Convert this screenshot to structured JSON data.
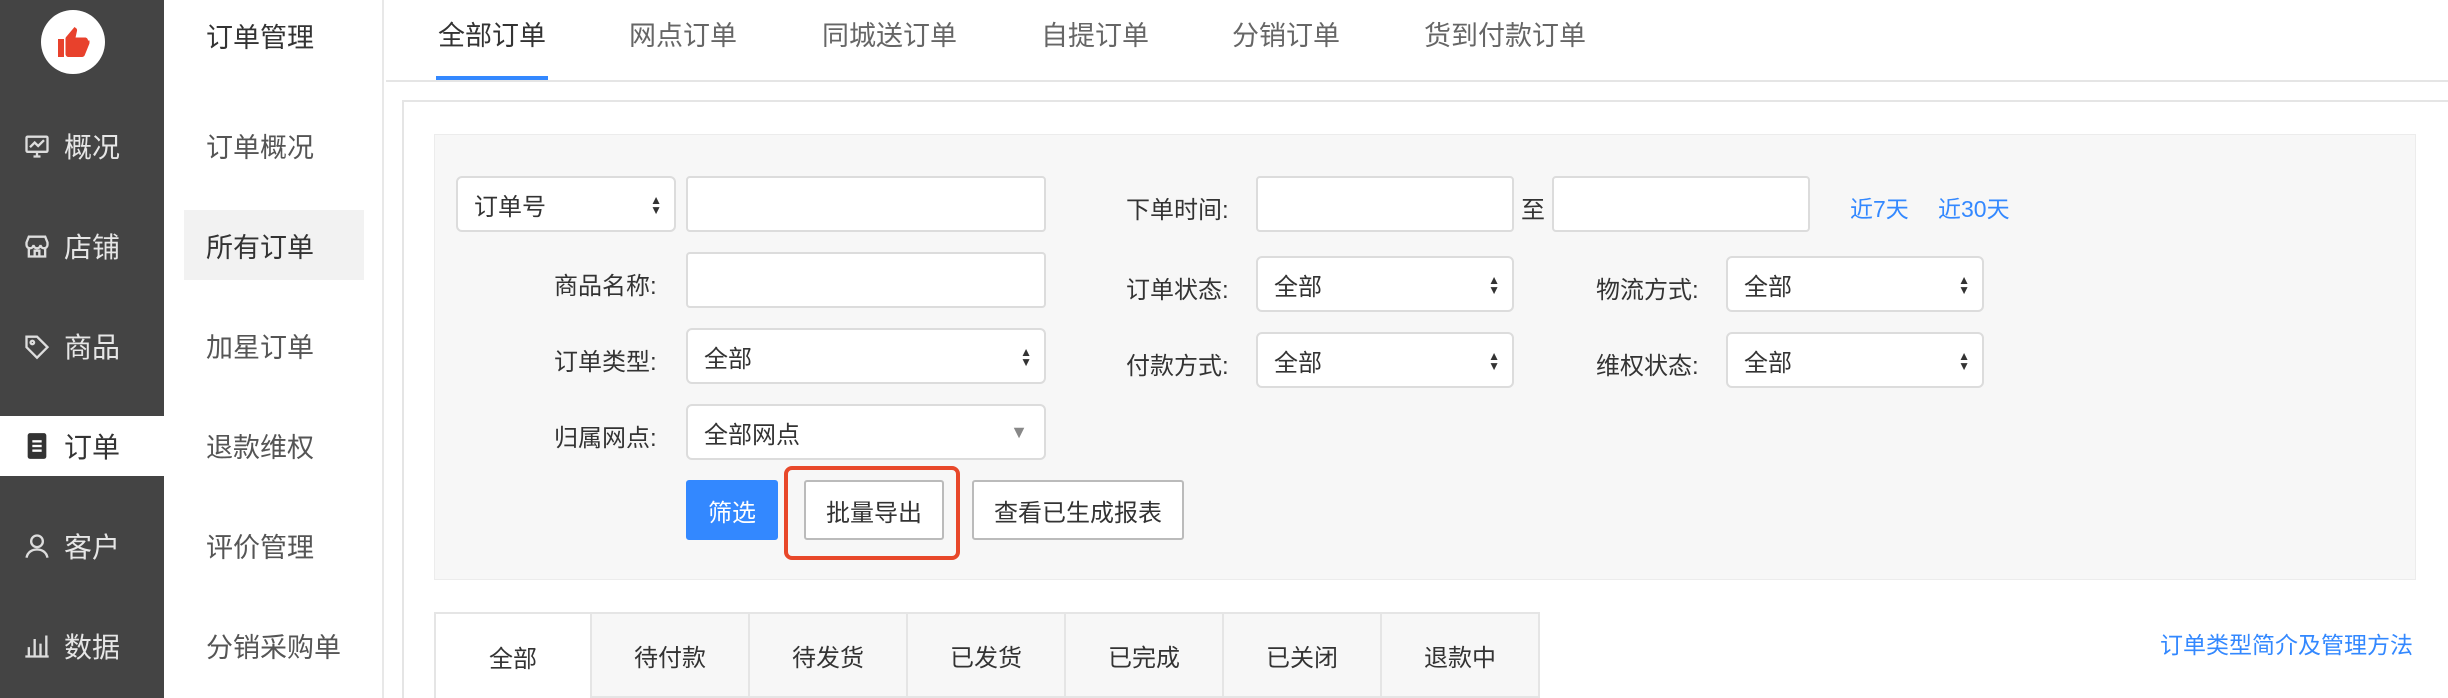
{
  "nav": {
    "items": [
      {
        "label": "概况",
        "icon": "dashboard-icon"
      },
      {
        "label": "店铺",
        "icon": "store-icon"
      },
      {
        "label": "商品",
        "icon": "tag-icon"
      },
      {
        "label": "订单",
        "icon": "order-icon"
      },
      {
        "label": "客户",
        "icon": "user-icon"
      },
      {
        "label": "数据",
        "icon": "chart-icon"
      }
    ],
    "active": "订单",
    "logo_icon": "thumbs-up-icon",
    "logo_color": "#e8412c"
  },
  "sub": {
    "title": "订单管理",
    "items": [
      "订单概况",
      "所有订单",
      "加星订单",
      "退款维权",
      "评价管理",
      "分销采购单"
    ],
    "active": "所有订单"
  },
  "top_tabs": {
    "items": [
      "全部订单",
      "网点订单",
      "同城送订单",
      "自提订单",
      "分销订单",
      "货到付款订单"
    ],
    "active": "全部订单"
  },
  "filter": {
    "order_no_select": "订单号",
    "order_no_value": "",
    "product_name_label": "商品名称:",
    "product_name_value": "",
    "order_type_label": "订单类型:",
    "order_type_value": "全部",
    "branch_label": "归属网点:",
    "branch_value": "全部网点",
    "order_time_label": "下单时间:",
    "time_start": "",
    "time_to": "至",
    "time_end": "",
    "last7": "近7天",
    "last30": "近30天",
    "order_status_label": "订单状态:",
    "order_status_value": "全部",
    "payment_label": "付款方式:",
    "payment_value": "全部",
    "logistics_label": "物流方式:",
    "logistics_value": "全部",
    "rights_label": "维权状态:",
    "rights_value": "全部",
    "filter_button": "筛选",
    "export_button": "批量导出",
    "report_button": "查看已生成报表"
  },
  "status_tabs": {
    "items": [
      "全部",
      "待付款",
      "待发货",
      "已发货",
      "已完成",
      "已关闭",
      "退款中"
    ],
    "active": "全部"
  },
  "help_link": "订单类型简介及管理方法",
  "colors": {
    "accent": "#3388ff",
    "highlight": "#e8482a",
    "nav_bg": "#444444"
  }
}
